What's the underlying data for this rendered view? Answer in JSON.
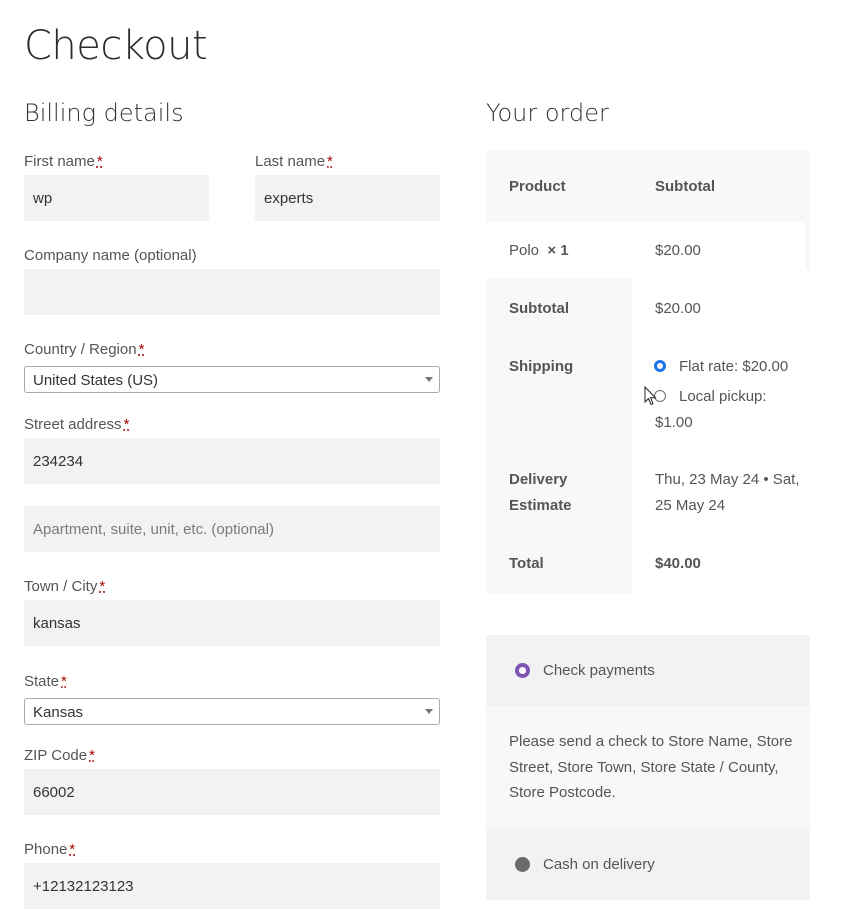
{
  "page": {
    "title": "Checkout"
  },
  "billing": {
    "title": "Billing details",
    "required_mark": "*",
    "first_name": {
      "label": "First name",
      "value": "wp"
    },
    "last_name": {
      "label": "Last name",
      "value": "experts"
    },
    "company": {
      "label": "Company name (optional)",
      "value": ""
    },
    "country": {
      "label": "Country / Region",
      "value": "United States (US)"
    },
    "street": {
      "label": "Street address",
      "value": "234234",
      "apt_placeholder": "Apartment, suite, unit, etc. (optional)"
    },
    "city": {
      "label": "Town / City",
      "value": "kansas"
    },
    "state": {
      "label": "State",
      "value": "Kansas"
    },
    "zip": {
      "label": "ZIP Code",
      "value": "66002"
    },
    "phone": {
      "label": "Phone",
      "value": "+12132123123"
    }
  },
  "order": {
    "title": "Your order",
    "header_product": "Product",
    "header_subtotal": "Subtotal",
    "item_name": "Polo",
    "item_qty": "× 1",
    "item_price": "$20.00",
    "subtotal_label": "Subtotal",
    "subtotal_value": "$20.00",
    "shipping_label": "Shipping",
    "shipping_options": [
      {
        "label": "Flat rate: $20.00",
        "selected": true
      },
      {
        "label": "Local pickup:",
        "price": "$1.00",
        "selected": false
      }
    ],
    "delivery_label_line1": "Delivery",
    "delivery_label_line2": "Estimate",
    "delivery_value_line1": "Thu, 23 May 24 • Sat,",
    "delivery_value_line2": "25 May 24",
    "total_label": "Total",
    "total_value": "$40.00"
  },
  "payment": {
    "methods": [
      {
        "label": "Check payments",
        "selected": true,
        "description_lines": [
          "Please send a check to Store Name, Store",
          "Street, Store Town, Store State / County,",
          "Store Postcode."
        ]
      },
      {
        "label": "Cash on delivery",
        "selected": false
      }
    ]
  },
  "colors": {
    "accent_purple": "#7f54b3",
    "radio_blue": "#1a73e8",
    "input_bg": "#f2f2f4",
    "panel_bg": "#f8f8fb"
  },
  "icons": {
    "cursor": "mouse-pointer-icon"
  }
}
